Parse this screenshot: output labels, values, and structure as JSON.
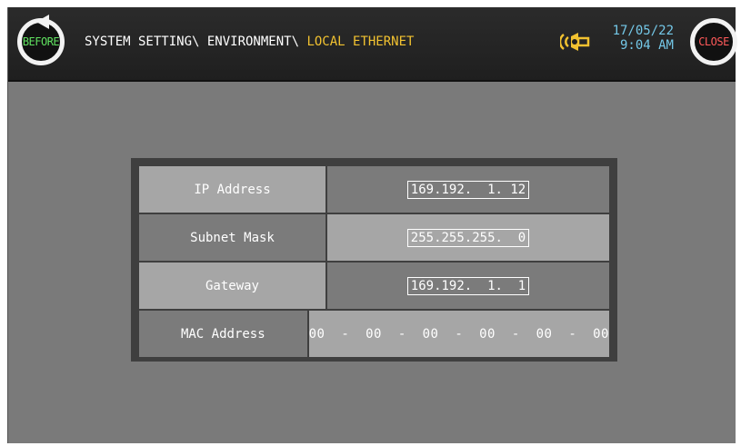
{
  "header": {
    "before_label": "BEFORE",
    "close_label": "CLOSE",
    "breadcrumb_path": "SYSTEM SETTING\\ ENVIRONMENT\\ ",
    "breadcrumb_current": "LOCAL ETHERNET",
    "date": "17/05/22",
    "time": "9:04 AM",
    "icons": [
      "back-arrow-icon",
      "speaker-icon"
    ]
  },
  "colors": {
    "before_text": "#5fe05f",
    "close_text": "#ff5a5a",
    "breadcrumb_current": "#f2c230",
    "datetime": "#74c8e8",
    "speaker": "#f2c230"
  },
  "network": {
    "rows": [
      {
        "label": "IP Address",
        "value": "169.192.  1. 12"
      },
      {
        "label": "Subnet Mask",
        "value": "255.255.255.  0"
      },
      {
        "label": "Gateway",
        "value": "169.192.  1.  1"
      },
      {
        "label": "MAC Address",
        "value": "00  -  00  -  00  -  00  -  00  -  00"
      }
    ]
  }
}
